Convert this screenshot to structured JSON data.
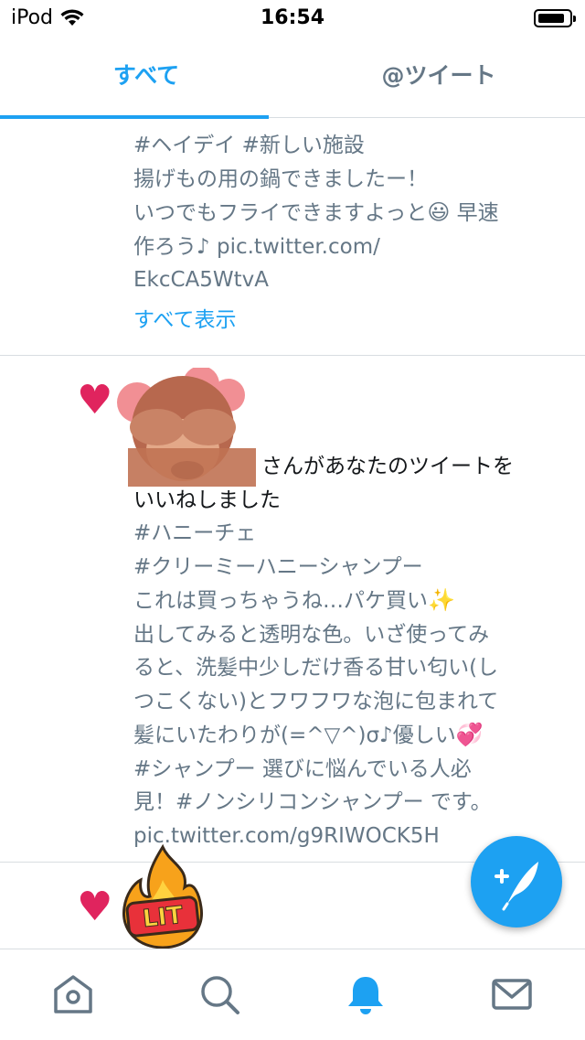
{
  "status": {
    "carrier": "iPod",
    "time": "16:54"
  },
  "tabs": [
    {
      "label": "すべて",
      "active": true
    },
    {
      "label": "@ツイート",
      "active": false
    }
  ],
  "feed": {
    "item1": {
      "lines": [
        "#ヘイデイ  #新しい施設",
        "揚げもの用の鍋できましたー！",
        "いつでもフライできますよっと",
        "作ろう♪ pic.twitter.com/",
        "EkcCA5WtvA"
      ],
      "line3_suffix": "早速",
      "show_all": "すべて表示"
    },
    "item2": {
      "notification_line1": "さんがあなたのツイートを",
      "notification_line2": "いいねしました",
      "lines": [
        "#ハニーチェ",
        "#クリーミーハニーシャンプー",
        "これは買っちゃうね…パケ買い",
        "出してみると透明な色。いざ使ってみ",
        "ると、洗髪中少しだけ香る甘い匂い(し",
        "つこくない)とフワフワな泡に包まれて",
        "髪にいたわりが(=^▽^)σ♪優しい",
        "#シャンプー 選びに悩んでいる人必",
        "見！#ノンシリコンシャンプー です。",
        "pic.twitter.com/g9RIWOCK5H"
      ]
    },
    "item3": {
      "sticker_text": "LIT"
    }
  },
  "icons": {
    "grinning_emoji": "😃",
    "sparkles_emoji": "✨",
    "hearts_emoji": "💞"
  },
  "colors": {
    "accent": "#1da1f2",
    "like": "#e0245e",
    "secondary_text": "#657786"
  }
}
